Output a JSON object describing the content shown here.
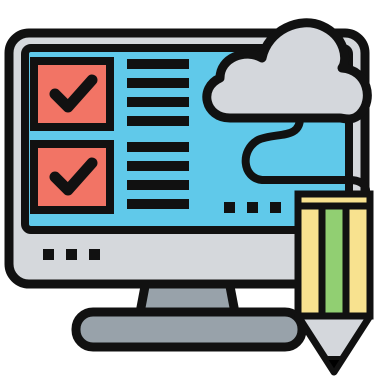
{
  "colors": {
    "outline": "#111111",
    "screen": "#60C9EA",
    "bezel": "#D5D8DC",
    "stand": "#98A2AA",
    "checkbox_fill": "#F27465",
    "cloud": "#D4D7DC",
    "pencil_yellow": "#F8E28F",
    "pencil_green": "#91CF72",
    "pencil_cone": "#D4D7DC",
    "pencil_tip": "#000000",
    "background": "#FFFFFF"
  },
  "icons": {
    "monitor": "monitor-icon",
    "checkbox": "checked-box-icon",
    "cloud": "cloud-icon",
    "pencil": "pencil-icon"
  }
}
